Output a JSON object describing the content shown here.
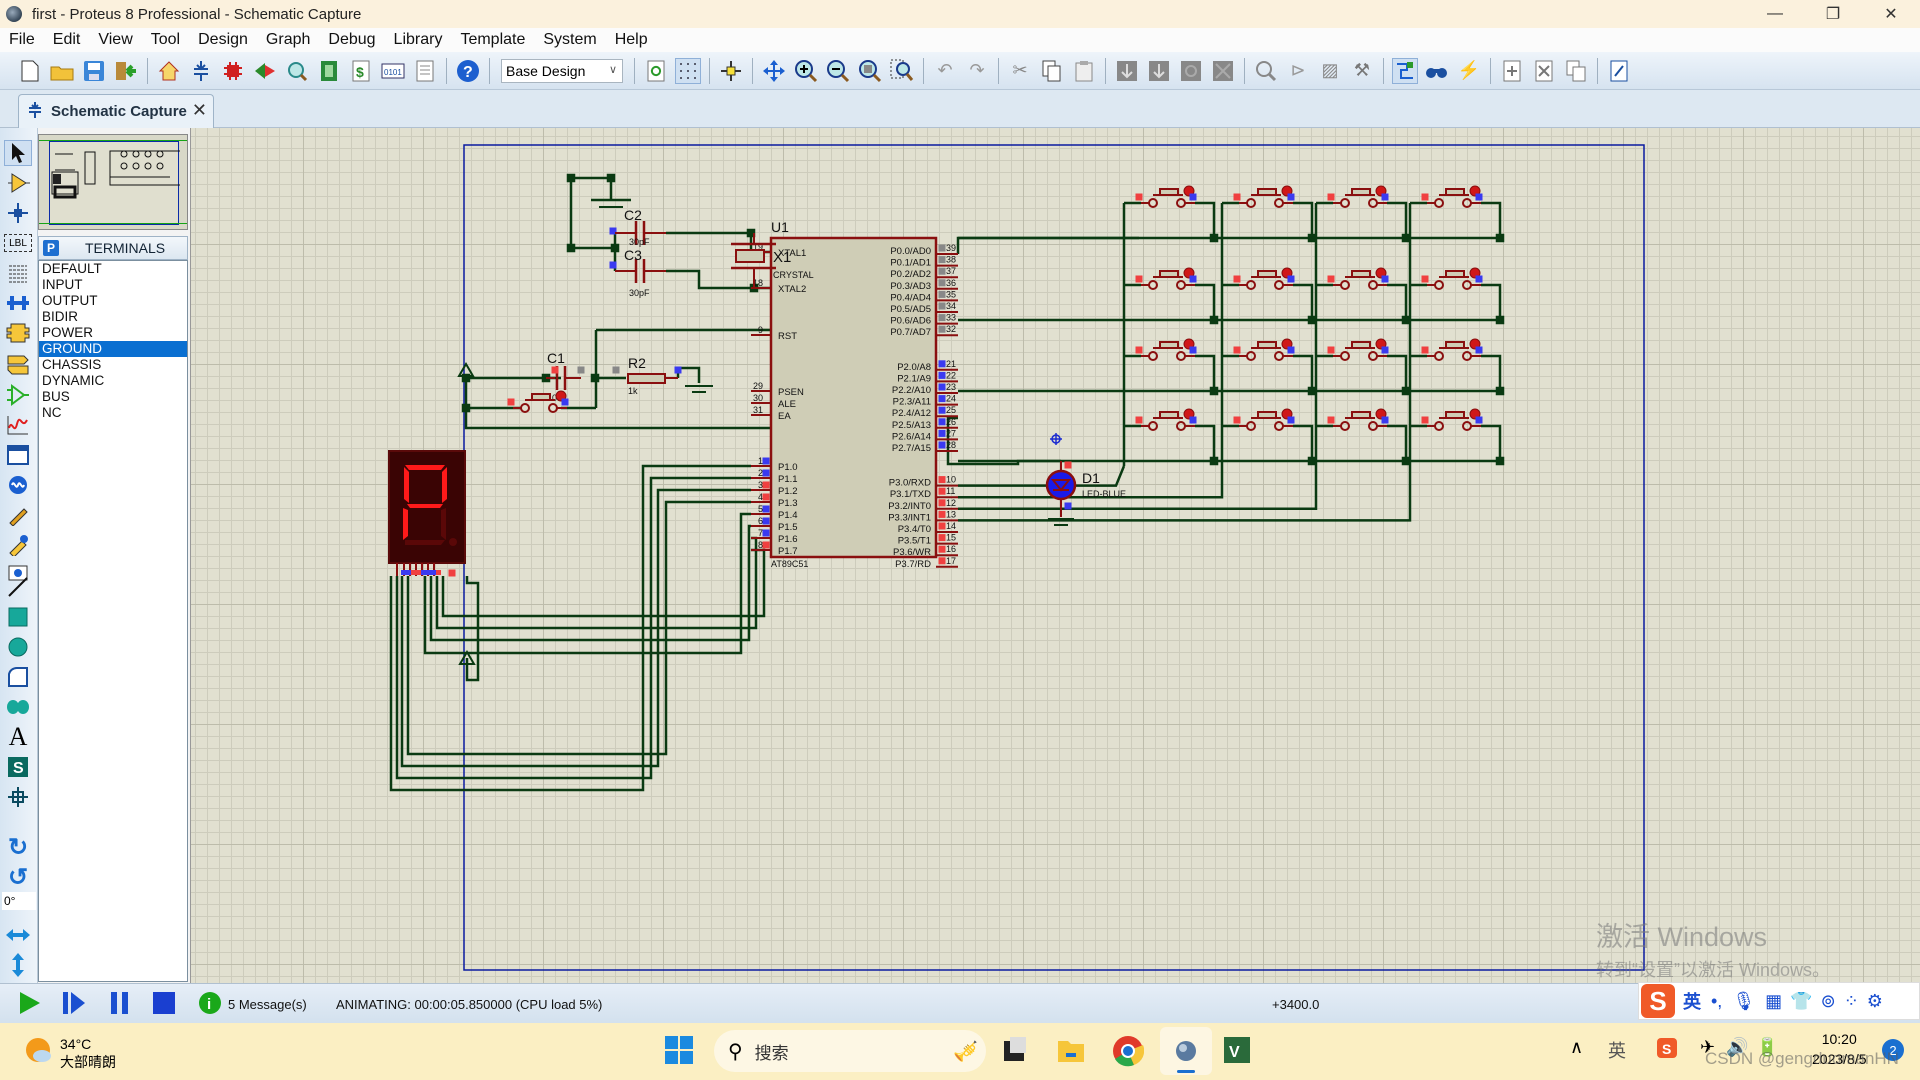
{
  "window": {
    "title": "first - Proteus 8 Professional - Schematic Capture",
    "controls": {
      "minimize": "—",
      "restore": "❐",
      "close": "✕"
    }
  },
  "menu": [
    "File",
    "Edit",
    "View",
    "Tool",
    "Design",
    "Graph",
    "Debug",
    "Library",
    "Template",
    "System",
    "Help"
  ],
  "toolbar": {
    "variant_select": "Base Design",
    "icons": [
      "new-file-icon",
      "open-folder-icon",
      "save-icon",
      "import-icon",
      "home-icon",
      "schematic-icon",
      "pcb-layout-icon",
      "3d-viewer-icon",
      "gerber-viewer-icon",
      "design-explorer-icon",
      "bill-of-materials-icon",
      "source-code-icon",
      "project-notes-icon",
      "help-icon",
      "refresh-icon",
      "grid-icon",
      "origin-icon",
      "pan-icon",
      "zoom-in-icon",
      "zoom-out-icon",
      "zoom-all-icon",
      "zoom-area-icon",
      "undo-icon",
      "redo-icon",
      "cut-icon",
      "copy-icon",
      "paste-icon",
      "block-copy-icon",
      "block-move-icon",
      "block-rotate-icon",
      "block-delete-icon",
      "pick-device-icon",
      "make-device-icon",
      "packaging-tool-icon",
      "decompose-icon",
      "wire-autorouter-icon",
      "search-tag-icon",
      "property-assignment-icon",
      "new-sheet-icon",
      "remove-sheet-icon",
      "exit-to-parent-icon",
      "netlist-icon"
    ]
  },
  "tabs": [
    {
      "label": "Schematic Capture",
      "active": true
    }
  ],
  "left_tools": {
    "rotation_value": "0°",
    "icons": [
      "selection-mode-icon",
      "component-mode-icon",
      "junction-dot-icon",
      "wire-label-icon",
      "text-script-icon",
      "buses-icon",
      "subcircuit-icon",
      "terminals-icon",
      "device-pins-icon",
      "graph-icon",
      "tape-recorder-icon",
      "generator-icon",
      "voltage-probe-icon",
      "current-probe-icon",
      "virtual-instruments-icon",
      "line-icon",
      "box-icon",
      "circle-icon",
      "arc-icon",
      "path-icon",
      "text-icon",
      "symbol-icon",
      "marker-icon",
      "rotate-clockwise-icon",
      "rotate-anticlockwise-icon",
      "mirror-horizontal-icon",
      "mirror-vertical-icon"
    ]
  },
  "device_selector": {
    "button": "P",
    "header": "TERMINALS",
    "items": [
      "DEFAULT",
      "INPUT",
      "OUTPUT",
      "BIDIR",
      "POWER",
      "GROUND",
      "CHASSIS",
      "DYNAMIC",
      "BUS",
      "NC"
    ],
    "selected": "GROUND"
  },
  "schematic": {
    "mcu": {
      "ref": "U1",
      "part": "AT89C51",
      "left_pins": [
        {
          "num": "19",
          "name": "XTAL1"
        },
        {
          "num": "18",
          "name": "XTAL2"
        },
        {
          "num": "9",
          "name": "RST"
        },
        {
          "num": "29",
          "name": "PSEN"
        },
        {
          "num": "30",
          "name": "ALE"
        },
        {
          "num": "31",
          "name": "EA"
        },
        {
          "num": "1",
          "name": "P1.0"
        },
        {
          "num": "2",
          "name": "P1.1"
        },
        {
          "num": "3",
          "name": "P1.2"
        },
        {
          "num": "4",
          "name": "P1.3"
        },
        {
          "num": "5",
          "name": "P1.4"
        },
        {
          "num": "6",
          "name": "P1.5"
        },
        {
          "num": "7",
          "name": "P1.6"
        },
        {
          "num": "8",
          "name": "P1.7"
        }
      ],
      "right_pins": [
        {
          "num": "39",
          "name": "P0.0/AD0"
        },
        {
          "num": "38",
          "name": "P0.1/AD1"
        },
        {
          "num": "37",
          "name": "P0.2/AD2"
        },
        {
          "num": "36",
          "name": "P0.3/AD3"
        },
        {
          "num": "35",
          "name": "P0.4/AD4"
        },
        {
          "num": "34",
          "name": "P0.5/AD5"
        },
        {
          "num": "33",
          "name": "P0.6/AD6"
        },
        {
          "num": "32",
          "name": "P0.7/AD7"
        },
        {
          "num": "21",
          "name": "P2.0/A8"
        },
        {
          "num": "22",
          "name": "P2.1/A9"
        },
        {
          "num": "23",
          "name": "P2.2/A10"
        },
        {
          "num": "24",
          "name": "P2.3/A11"
        },
        {
          "num": "25",
          "name": "P2.4/A12"
        },
        {
          "num": "26",
          "name": "P2.5/A13"
        },
        {
          "num": "27",
          "name": "P2.6/A14"
        },
        {
          "num": "28",
          "name": "P2.7/A15"
        },
        {
          "num": "10",
          "name": "P3.0/RXD"
        },
        {
          "num": "11",
          "name": "P3.1/TXD"
        },
        {
          "num": "12",
          "name": "P3.2/INT0"
        },
        {
          "num": "13",
          "name": "P3.3/INT1"
        },
        {
          "num": "14",
          "name": "P3.4/T0"
        },
        {
          "num": "15",
          "name": "P3.5/T1"
        },
        {
          "num": "16",
          "name": "P3.6/WR"
        },
        {
          "num": "17",
          "name": "P3.7/RD"
        }
      ]
    },
    "crystal": {
      "ref": "X1",
      "value": "CRYSTAL"
    },
    "caps": [
      {
        "ref": "C2",
        "value": "30pF"
      },
      {
        "ref": "C3",
        "value": "30pF"
      },
      {
        "ref": "C1",
        "value": "10u"
      }
    ],
    "resistor": {
      "ref": "R2",
      "value": "1k"
    },
    "led": {
      "ref": "D1",
      "value": "LED-BLUE"
    },
    "seven_segment": {
      "displayed_char": "P"
    },
    "keypad": {
      "rows": 4,
      "cols": 4
    }
  },
  "watermark": {
    "line1": "激活 Windows",
    "line2": "转到“设置”以激活 Windows。"
  },
  "statusbar": {
    "messages": "5 Message(s)",
    "animation_status": "ANIMATING: 00:00:05.850000 (CPU load 5%)",
    "coordinate": "+3400.0"
  },
  "ime": {
    "lang": "英",
    "icons": [
      "sogou-icon",
      "punctuation-icon",
      "microphone-icon",
      "keyboard-icon",
      "skin-icon",
      "game-icon",
      "toolbox-icon",
      "settings-icon"
    ]
  },
  "taskbar": {
    "weather_temp": "34°C",
    "weather_desc": "大部晴朗",
    "search_placeholder": "搜索",
    "apps": [
      "start-icon",
      "task-view-icon",
      "file-explorer-icon",
      "chrome-icon",
      "proteus-icon",
      "vivado-icon"
    ],
    "tray_lang": "英",
    "time": "10:20",
    "date": "2023/8/5",
    "notification_count": "2",
    "csdn_watermark": "CSDN @gengduomanHN"
  }
}
